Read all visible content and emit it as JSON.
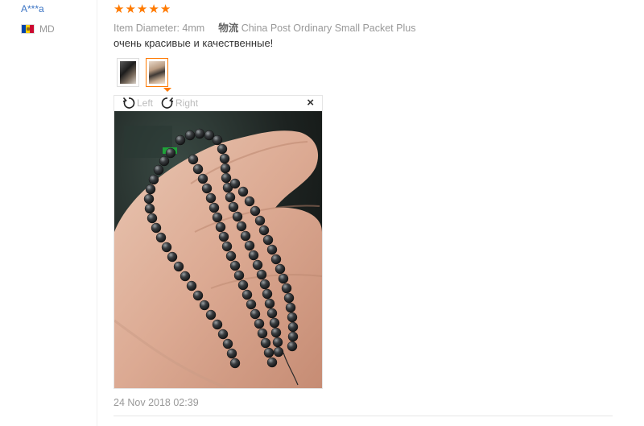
{
  "reviewer": {
    "name": "A***a",
    "country_code": "MD",
    "flag_colors": [
      "#0046ae",
      "#ffd200",
      "#cc092f"
    ]
  },
  "review": {
    "stars": 5,
    "star_color": "#ff7a00",
    "item_diameter": "Item Diameter: 4mm",
    "logistics_label": "物流",
    "logistics_value": "China Post Ordinary Small Packet Plus",
    "text": "очень красивые и качественные!",
    "date": "24 Nov 2018 02:39"
  },
  "viewer": {
    "rotate_left_label": "Left",
    "rotate_right_label": "Right",
    "close_glyph": "×",
    "selected_thumbnail": 2,
    "thumbnail_count": 2
  },
  "icons": {
    "rotate_left": "rotate-left-icon",
    "rotate_right": "rotate-right-icon",
    "close": "close-icon",
    "star": "star-icon"
  }
}
